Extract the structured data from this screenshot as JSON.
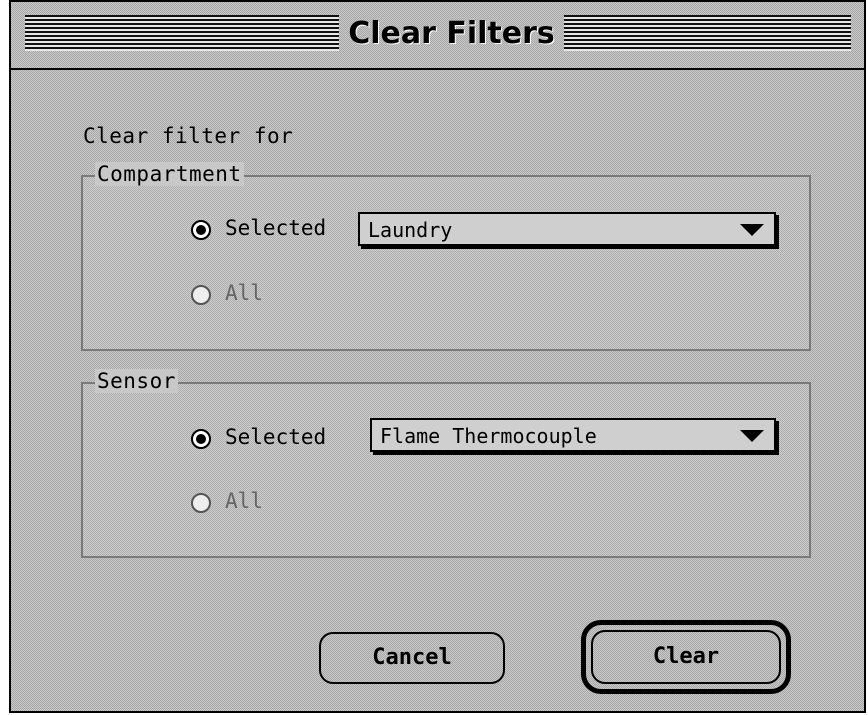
{
  "dialog": {
    "title": "Clear Filters",
    "prompt": "Clear filter for",
    "compartment": {
      "legend": "Compartment",
      "selected_label": "Selected",
      "all_label": "All",
      "selected_option": "selected",
      "value": "Laundry"
    },
    "sensor": {
      "legend": "Sensor",
      "selected_label": "Selected",
      "all_label": "All",
      "selected_option": "selected",
      "value": "Flame Thermocouple"
    },
    "buttons": {
      "cancel": "Cancel",
      "clear": "Clear",
      "default": "clear"
    }
  }
}
